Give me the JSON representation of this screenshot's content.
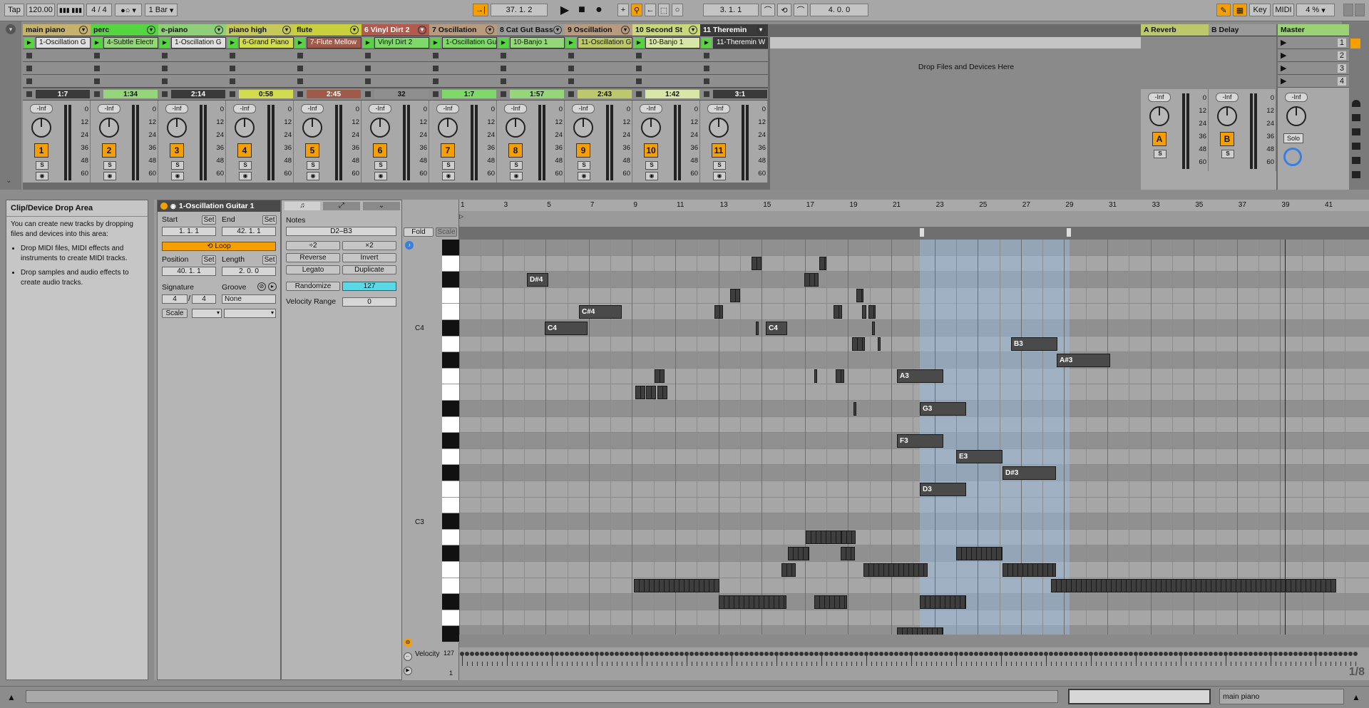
{
  "transport": {
    "tap": "Tap",
    "tempo": "120.00",
    "meter_num": "4",
    "meter_den": "4",
    "quantize": "1 Bar",
    "position": "37.  1.  2",
    "loop_start": "3.  1.  1",
    "loop_length": "4.  0.  0",
    "key": "Key",
    "midi": "MIDI",
    "cpu": "4 %"
  },
  "tracks": [
    {
      "name": "main piano",
      "color": "#c6b26a",
      "clip": "1-Oscillation G",
      "clip_color": "#e0e0e0",
      "pos": "1:7",
      "pos_color": "#3a3a3a",
      "pos_text": "#fff",
      "num": "1"
    },
    {
      "name": "perc",
      "color": "#55d640",
      "clip": "4-Subtle Electr",
      "clip_color": "#95d67a",
      "pos": "1:34",
      "pos_color": "#95d67a",
      "pos_text": "#111",
      "num": "2"
    },
    {
      "name": "e-piano",
      "color": "#8ecf78",
      "clip": "1-Oscillation G",
      "clip_color": "#e0e0e0",
      "pos": "2:14",
      "pos_color": "#3a3a3a",
      "pos_text": "#fff",
      "num": "3"
    },
    {
      "name": "piano high",
      "color": "#c6c85a",
      "clip": "6-Grand Piano",
      "clip_color": "#d3db4e",
      "pos": "0:58",
      "pos_color": "#d3db4e",
      "pos_text": "#111",
      "num": "4"
    },
    {
      "name": "flute",
      "color": "#c8d13b",
      "clip": "7-Flute Mellow",
      "clip_color": "#a05a4a",
      "pos": "2:45",
      "pos_color": "#a05a4a",
      "pos_text": "#fff",
      "num": "5"
    },
    {
      "name": "6 Vinyl Dirt 2",
      "color": "#b35a4f",
      "clip": "Vinyl Dirt 2",
      "clip_color": "#7fd968",
      "pos": "32",
      "pos_color": "#8f8f8f",
      "pos_text": "#111",
      "num": "6"
    },
    {
      "name": "7 Oscillation",
      "color": "#b89a7e",
      "clip": "1-Oscillation Gu",
      "clip_color": "#7fd968",
      "pos": "1:7",
      "pos_color": "#7fd968",
      "pos_text": "#111",
      "num": "7"
    },
    {
      "name": "8 Cat Gut Bass",
      "color": "#9a9a9a",
      "clip": "10-Banjo 1",
      "clip_color": "#95d67a",
      "pos": "1:57",
      "pos_color": "#95d67a",
      "pos_text": "#111",
      "num": "8"
    },
    {
      "name": "9 Oscillation",
      "color": "#b89a7e",
      "clip": "11-Oscillation G",
      "clip_color": "#bcc86a",
      "pos": "2:43",
      "pos_color": "#bcc86a",
      "pos_text": "#111",
      "num": "9"
    },
    {
      "name": "10 Second St",
      "color": "#c9d97a",
      "clip": "10-Banjo 1",
      "clip_color": "#d8e7a8",
      "pos": "1:42",
      "pos_color": "#d8e7a8",
      "pos_text": "#111",
      "num": "10"
    },
    {
      "name": "11 Theremin",
      "color": "#3a3a3a",
      "clip": "11-Theremin W",
      "clip_color": "#3a3a3a",
      "pos": "3:1",
      "pos_color": "#3a3a3a",
      "pos_text": "#fff",
      "num": "11"
    }
  ],
  "returns": [
    {
      "name": "A Reverb",
      "color": "#bcc86a",
      "num": "A"
    },
    {
      "name": "B Delay",
      "color": "#9a9a9a",
      "num": "B"
    }
  ],
  "master": {
    "name": "Master",
    "color": "#9ad274",
    "scenes": [
      "1",
      "2",
      "3",
      "4"
    ],
    "solo": "Solo"
  },
  "session": {
    "drop_hint": "Drop Files and Devices Here"
  },
  "mixer": {
    "vol": "-Inf",
    "scale": [
      "0",
      "12",
      "24",
      "36",
      "48",
      "60"
    ],
    "solo": "S"
  },
  "info": {
    "title": "Clip/Device Drop Area",
    "body": "You can create new tracks by dropping files and devices into this area:",
    "bullets": [
      "Drop MIDI files, MIDI effects and instruments to create MIDI tracks.",
      "Drop samples and audio effects to create audio tracks."
    ]
  },
  "clip": {
    "name": "1-Oscillation Guitar 1",
    "start": "Start",
    "set": "Set",
    "end": "End",
    "start_val": "1.   1.   1",
    "end_val": "42.   1.   1",
    "loop": "Loop",
    "position": "Position",
    "length": "Length",
    "pos_val": "40.   1.   1",
    "len_val": "2.   0.   0",
    "signature": "Signature",
    "groove": "Groove",
    "sig_num": "4",
    "sig_den": "4",
    "groove_val": "None",
    "scale": "Scale"
  },
  "notes": {
    "label": "Notes",
    "range": "D2–B3",
    "div2": "÷2",
    "mul2": "×2",
    "reverse": "Reverse",
    "invert": "Invert",
    "legato": "Legato",
    "duplicate": "Duplicate",
    "randomize": "Randomize",
    "rand_val": "127",
    "vel_range": "Velocity Range",
    "vel_range_val": "0"
  },
  "editor": {
    "fold": "Fold",
    "scale": "Scale",
    "c4": "C4",
    "c3": "C3",
    "velocity": "Velocity",
    "vel_max": "127",
    "vel_min": "1",
    "zoom": "1/8",
    "bars": [
      "1",
      "3",
      "5",
      "7",
      "9",
      "11",
      "13",
      "15",
      "17",
      "19",
      "21",
      "23",
      "25",
      "27",
      "29",
      "31",
      "33",
      "35",
      "37",
      "39",
      "41"
    ]
  },
  "note_labels": [
    {
      "t": "D#4"
    },
    {
      "t": "C#4"
    },
    {
      "t": "C4"
    },
    {
      "t": "C4"
    },
    {
      "t": "B3"
    },
    {
      "t": "A#3"
    },
    {
      "t": "A3"
    },
    {
      "t": "G3"
    },
    {
      "t": "F3"
    },
    {
      "t": "E3"
    },
    {
      "t": "D#3"
    },
    {
      "t": "D3"
    }
  ],
  "status": {
    "track": "main piano"
  }
}
